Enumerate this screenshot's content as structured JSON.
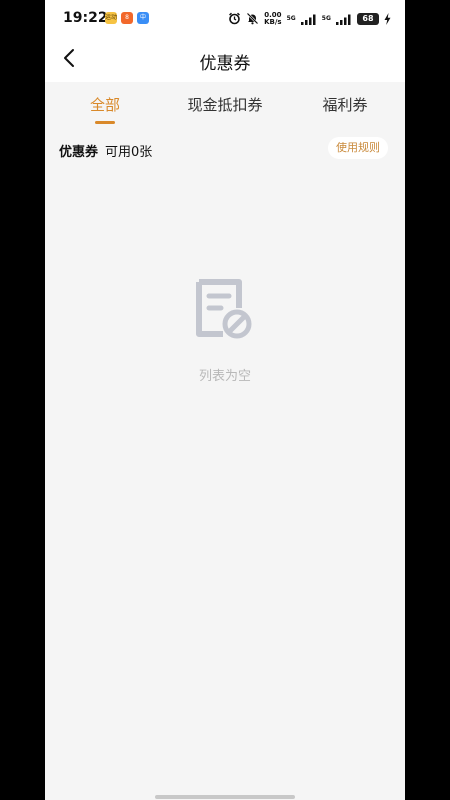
{
  "status_bar": {
    "time": "19:22",
    "app_badges": [
      "运动",
      "8",
      "中"
    ],
    "net_speed_value": "0.00",
    "net_speed_unit": "KB/s",
    "sim1_label": "5G",
    "sim2_label": "5G",
    "battery": "68",
    "icons": [
      "alarm-icon",
      "mute-icon",
      "signal-icon",
      "signal-icon",
      "battery-icon",
      "charging-icon"
    ]
  },
  "nav": {
    "title": "优惠券"
  },
  "tabs": [
    {
      "label": "全部",
      "active": true
    },
    {
      "label": "现金抵扣券",
      "active": false
    },
    {
      "label": "福利券",
      "active": false
    }
  ],
  "summary": {
    "title": "优惠券",
    "count_text": "可用0张",
    "rules_label": "使用规则"
  },
  "empty_state": {
    "icon": "empty-document-icon",
    "text": "列表为空"
  },
  "colors": {
    "accent": "#d9892a",
    "page_bg": "#f5f5f5",
    "muted": "#b8b8b8"
  }
}
